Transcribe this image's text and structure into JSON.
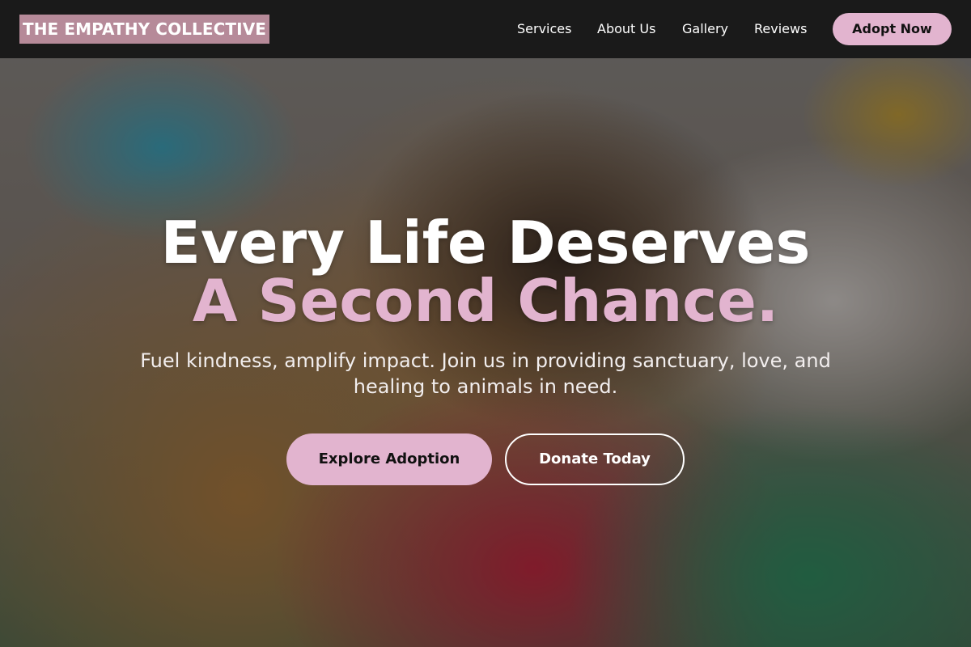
{
  "nav": {
    "brand": "THE EMPATHY COLLECTIVE",
    "links": [
      "Services",
      "About Us",
      "Gallery",
      "Reviews"
    ],
    "cta": "Adopt Now"
  },
  "hero": {
    "background_image": "dog-in-red-bandana-photo",
    "headline_line1": "Every Life Deserves",
    "headline_line2": "A Second Chance.",
    "subtext": "Fuel kindness, amplify impact. Join us in providing sanctuary, love, and healing to animals in need.",
    "primary_button": "Explore Adoption",
    "secondary_button": "Donate Today"
  },
  "colors": {
    "accent": "#e2b4cf",
    "brand_bg": "#b68a99",
    "nav_bg": "#1a1a1a"
  }
}
